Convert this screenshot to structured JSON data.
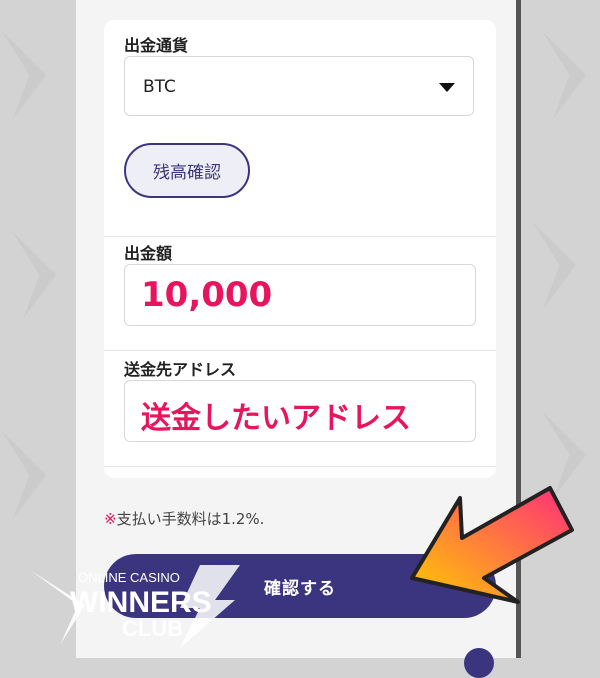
{
  "form": {
    "currency_label": "出金通貨",
    "currency_value": "BTC",
    "balance_button": "残高確認",
    "amount_label": "出金額",
    "amount_value": "10,000",
    "address_label": "送金先アドレス",
    "address_value": "送金したいアドレス"
  },
  "note": {
    "mark": "※",
    "text": "支払い手数料は1.2%."
  },
  "confirm_button": "確認する",
  "watermark": {
    "line1": "ONLINE CASINO",
    "line2": "WINNERS",
    "line3": "CLUB"
  },
  "colors": {
    "accent": "#3b3580",
    "highlight": "#e8145c",
    "arrow_start": "#ffcc00",
    "arrow_end": "#ff2d7a"
  },
  "icons": {
    "select_arrow": "caret-down-icon",
    "annotation": "pointer-arrow-icon"
  }
}
